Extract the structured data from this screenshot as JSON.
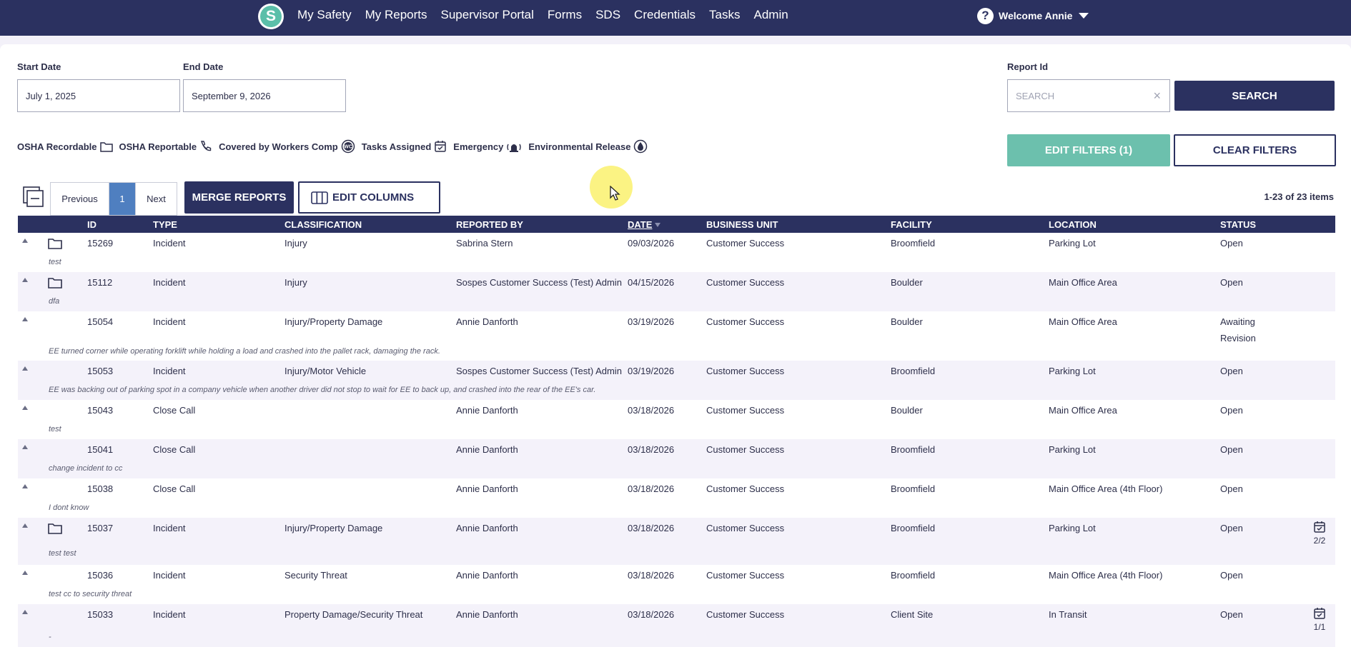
{
  "nav": {
    "logo_letter": "S",
    "links": [
      "My Safety",
      "My Reports",
      "Supervisor Portal",
      "Forms",
      "SDS",
      "Credentials",
      "Tasks",
      "Admin"
    ],
    "welcome": "Welcome Annie"
  },
  "filters": {
    "start_label": "Start Date",
    "start_value": "July 1, 2025",
    "end_label": "End Date",
    "end_value": "September 9, 2026",
    "report_label": "Report Id",
    "report_placeholder": "SEARCH",
    "search_button": "SEARCH",
    "edit_filters_button": "EDIT FILTERS (1)",
    "clear_filters_button": "CLEAR FILTERS"
  },
  "legend": [
    "OSHA Recordable",
    "OSHA Reportable",
    "Covered by Workers Comp",
    "Tasks Assigned",
    "Emergency",
    "Environmental Release"
  ],
  "pager": {
    "prev": "Previous",
    "page": "1",
    "next": "Next",
    "merge_button": "MERGE REPORTS",
    "edit_columns_button": "EDIT COLUMNS",
    "items_count": "1-23 of 23 items"
  },
  "table": {
    "headers": [
      "ID",
      "TYPE",
      "CLASSIFICATION",
      "REPORTED BY",
      "DATE",
      "BUSINESS UNIT",
      "FACILITY",
      "LOCATION",
      "STATUS"
    ],
    "rows": [
      {
        "id": "15269",
        "type": "Incident",
        "classification": "Injury",
        "reported_by": "Sabrina Stern",
        "date": "09/03/2026",
        "business_unit": "Customer Success",
        "facility": "Broomfield",
        "location": "Parking Lot",
        "status": "Open",
        "status2": "",
        "desc": "test",
        "task": ""
      },
      {
        "id": "15112",
        "type": "Incident",
        "classification": "Injury",
        "reported_by": "Sospes Customer Success (Test) Admin",
        "date": "04/15/2026",
        "business_unit": "Customer Success",
        "facility": "Boulder",
        "location": "Main Office Area",
        "status": "Open",
        "status2": "",
        "desc": "dfa",
        "task": ""
      },
      {
        "id": "15054",
        "type": "Incident",
        "classification": "Injury/Property Damage",
        "reported_by": "Annie Danforth",
        "date": "03/19/2026",
        "business_unit": "Customer Success",
        "facility": "Boulder",
        "location": "Main Office Area",
        "status": "Awaiting",
        "status2": "Revision",
        "desc": "EE turned corner while operating forklift while holding a load and crashed into the pallet rack, damaging the rack.",
        "task": ""
      },
      {
        "id": "15053",
        "type": "Incident",
        "classification": "Injury/Motor Vehicle",
        "reported_by": "Sospes Customer Success (Test) Admin",
        "date": "03/19/2026",
        "business_unit": "Customer Success",
        "facility": "Broomfield",
        "location": "Parking Lot",
        "status": "Open",
        "status2": "",
        "desc": "EE was backing out of parking spot in a company vehicle when another driver did not stop to wait for EE to back up, and crashed into the rear of the EE's car.",
        "task": ""
      },
      {
        "id": "15043",
        "type": "Close Call",
        "classification": "",
        "reported_by": "Annie Danforth",
        "date": "03/18/2026",
        "business_unit": "Customer Success",
        "facility": "Boulder",
        "location": "Main Office Area",
        "status": "Open",
        "status2": "",
        "desc": "test",
        "task": ""
      },
      {
        "id": "15041",
        "type": "Close Call",
        "classification": "",
        "reported_by": "Annie Danforth",
        "date": "03/18/2026",
        "business_unit": "Customer Success",
        "facility": "Broomfield",
        "location": "Parking Lot",
        "status": "Open",
        "status2": "",
        "desc": "change incident to cc",
        "task": ""
      },
      {
        "id": "15038",
        "type": "Close Call",
        "classification": "",
        "reported_by": "Annie Danforth",
        "date": "03/18/2026",
        "business_unit": "Customer Success",
        "facility": "Broomfield",
        "location": "Main Office Area (4th Floor)",
        "status": "Open",
        "status2": "",
        "desc": "I dont know",
        "task": ""
      },
      {
        "id": "15037",
        "type": "Incident",
        "classification": "Injury/Property Damage",
        "reported_by": "Annie Danforth",
        "date": "03/18/2026",
        "business_unit": "Customer Success",
        "facility": "Broomfield",
        "location": "Parking Lot",
        "status": "Open",
        "status2": "",
        "desc": "test test",
        "task": "2/2"
      },
      {
        "id": "15036",
        "type": "Incident",
        "classification": "Security Threat",
        "reported_by": "Annie Danforth",
        "date": "03/18/2026",
        "business_unit": "Customer Success",
        "facility": "Broomfield",
        "location": "Main Office Area (4th Floor)",
        "status": "Open",
        "status2": "",
        "desc": "test cc to security threat",
        "task": ""
      },
      {
        "id": "15033",
        "type": "Incident",
        "classification": "Property Damage/Security Threat",
        "reported_by": "Annie Danforth",
        "date": "03/18/2026",
        "business_unit": "Customer Success",
        "facility": "Client Site",
        "location": "In Transit",
        "status": "Open",
        "status2": "",
        "desc": "-",
        "task": "1/1"
      }
    ]
  }
}
